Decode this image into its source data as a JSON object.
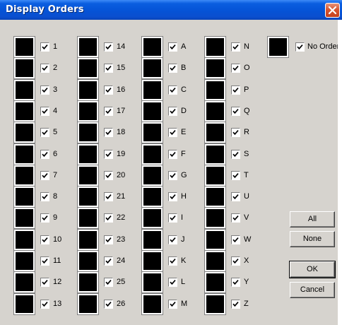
{
  "window": {
    "title": "Display Orders"
  },
  "columns": [
    [
      "1",
      "2",
      "3",
      "4",
      "5",
      "6",
      "7",
      "8",
      "9",
      "10",
      "11",
      "12",
      "13"
    ],
    [
      "14",
      "15",
      "16",
      "17",
      "18",
      "19",
      "20",
      "21",
      "22",
      "23",
      "24",
      "25",
      "26"
    ],
    [
      "A",
      "B",
      "C",
      "D",
      "E",
      "F",
      "G",
      "H",
      "I",
      "J",
      "K",
      "L",
      "M"
    ],
    [
      "N",
      "O",
      "P",
      "Q",
      "R",
      "S",
      "T",
      "U",
      "V",
      "W",
      "X",
      "Y",
      "Z"
    ]
  ],
  "no_order": {
    "label": "No Order",
    "checked": true
  },
  "buttons": {
    "all": "All",
    "none": "None",
    "ok": "OK",
    "cancel": "Cancel"
  },
  "colors": {
    "swatch": "#000000",
    "face": "#d6d3ce",
    "title_blue": "#0553d6",
    "close_red": "#d9552f"
  },
  "icons": {
    "close": "close-icon",
    "check": "checkmark-icon"
  }
}
